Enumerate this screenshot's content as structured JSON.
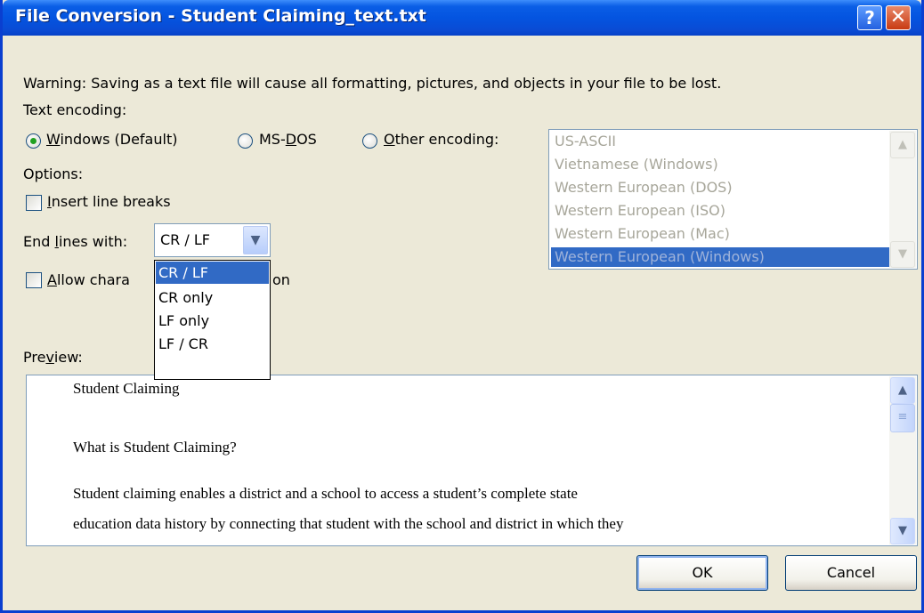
{
  "window": {
    "title": "File Conversion - Student Claiming_text.txt",
    "help_glyph": "?",
    "close_glyph": "✕"
  },
  "warning": "Warning: Saving as a text file will cause all formatting, pictures, and objects in your file to be lost.",
  "encoding": {
    "label": "Text encoding:",
    "windows": {
      "key": "W",
      "rest": "indows (Default)"
    },
    "msdos": {
      "pre": "MS-",
      "key": "D",
      "rest": "OS"
    },
    "other": {
      "key": "O",
      "rest": "ther encoding:"
    },
    "selected": "Windows (Default)",
    "list": [
      "US-ASCII",
      "Vietnamese (Windows)",
      "Western European (DOS)",
      "Western European (ISO)",
      "Western European (Mac)",
      "Western European (Windows)"
    ],
    "list_selected": "Western European (Windows)"
  },
  "options": {
    "label": "Options:",
    "insert_line_breaks": {
      "key": "I",
      "rest": "nsert line breaks",
      "checked": false
    },
    "end_lines": {
      "pre": "End ",
      "key": "l",
      "rest": "ines with:",
      "value": "CR / LF"
    },
    "allow_char": {
      "key": "A",
      "rest": "llow chara",
      "tail": "on",
      "checked": false
    }
  },
  "dropdown_options": [
    "CR / LF",
    "CR only",
    "LF only",
    "LF / CR"
  ],
  "preview": {
    "label_pre": "Pre",
    "label_key": "v",
    "label_rest": "iew:",
    "lines": [
      "Student Claiming",
      "What is Student Claiming?",
      "Student claiming enables a district and a school to access a student’s complete state",
      "education data history by connecting that student with the school and district in which they"
    ]
  },
  "buttons": {
    "ok": "OK",
    "cancel": "Cancel"
  },
  "colors": {
    "titlebar": "#0454e0",
    "selection": "#316ac5",
    "dialog_bg": "#ece9d8"
  }
}
